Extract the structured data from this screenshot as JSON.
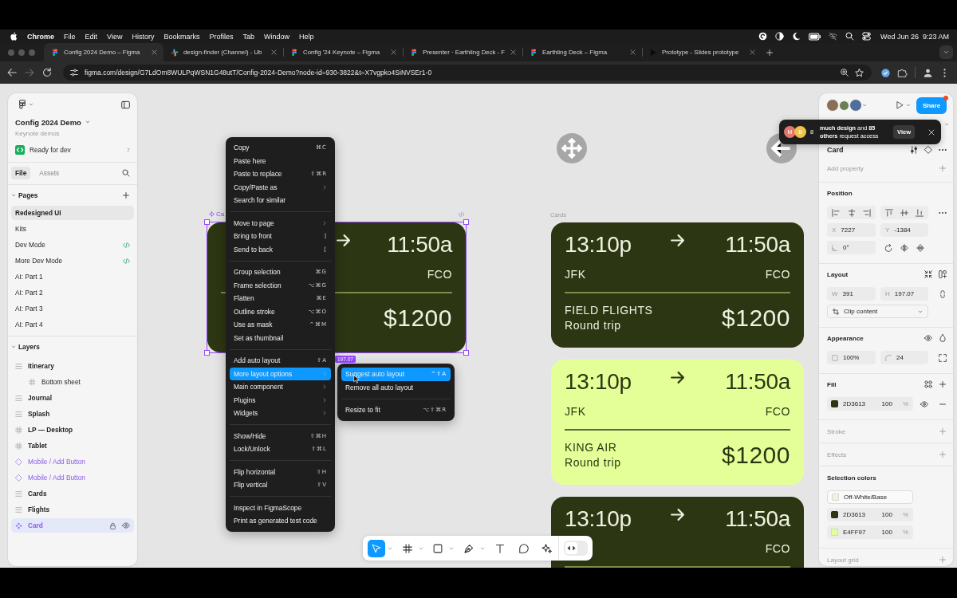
{
  "menubar": {
    "app": "Chrome",
    "menus": [
      "File",
      "Edit",
      "View",
      "History",
      "Bookmarks",
      "Profiles",
      "Tab",
      "Window",
      "Help"
    ],
    "date": "Wed Jun 26",
    "time": "9:23 AM"
  },
  "tabs": [
    {
      "title": "Config 2024 Demo – Figma",
      "kind": "figma",
      "selected": true
    },
    {
      "title": "design-finder (Channel) - Ub",
      "kind": "slack",
      "selected": false
    },
    {
      "title": "Config '24 Keynote – Figma",
      "kind": "figma",
      "selected": false
    },
    {
      "title": "Presenter · Earthling Deck - F",
      "kind": "figma",
      "selected": false
    },
    {
      "title": "Earthling Deck – Figma",
      "kind": "figma",
      "selected": false
    },
    {
      "title": "Prototype - Slides prototype",
      "kind": "prototype",
      "selected": false
    }
  ],
  "address_bar": {
    "url": "figma.com/design/G7LdOm8WULPqWSN1G48utT/Config-2024-Demo?node-id=930-3822&t=X7vgpko4SiNVSEr1-0"
  },
  "sidebar": {
    "file_name": "Config 2024 Demo",
    "team": "Keynote demos",
    "status": {
      "label": "Ready for dev",
      "count": "7"
    },
    "tabs": [
      {
        "label": "File",
        "selected": true
      },
      {
        "label": "Assets",
        "selected": false
      }
    ],
    "pages": {
      "title": "Pages",
      "expanded": true,
      "items": [
        {
          "name": "Redesigned UI",
          "selected": true,
          "dev_mode": false
        },
        {
          "name": "Kits",
          "selected": false,
          "dev_mode": false
        },
        {
          "name": "Dev Mode",
          "selected": false,
          "dev_mode": true
        },
        {
          "name": "More Dev Mode",
          "selected": false,
          "dev_mode": true
        },
        {
          "name": "AI: Part 1",
          "selected": false,
          "dev_mode": false
        },
        {
          "name": "AI: Part 2",
          "selected": false,
          "dev_mode": false
        },
        {
          "name": "AI: Part 3",
          "selected": false,
          "dev_mode": false
        },
        {
          "name": "AI: Part 4",
          "selected": false,
          "dev_mode": false
        }
      ]
    },
    "layers": {
      "title": "Layers",
      "expanded": true,
      "items": [
        {
          "name": "Itinerary",
          "kind": "stack",
          "selected": false,
          "children": [
            {
              "name": "Bottom sheet",
              "kind": "grid",
              "selected": false
            }
          ]
        },
        {
          "name": "Journal",
          "kind": "stack",
          "selected": false
        },
        {
          "name": "Splash",
          "kind": "stack",
          "selected": false
        },
        {
          "name": "LP — Desktop",
          "kind": "frame",
          "selected": false
        },
        {
          "name": "Tablet",
          "kind": "frame",
          "selected": false
        },
        {
          "name": "Mobile / Add Button",
          "kind": "instance",
          "selected": false
        },
        {
          "name": "Mobile / Add Button",
          "kind": "instance",
          "selected": false
        },
        {
          "name": "Cards",
          "kind": "stack",
          "selected": false
        },
        {
          "name": "Flights",
          "kind": "stack",
          "selected": false
        },
        {
          "name": "Card",
          "kind": "component",
          "selected": true
        }
      ]
    }
  },
  "canvas": {
    "selection": {
      "label": "Ca",
      "size": "197.07",
      "card": {
        "arrive": "11:50a",
        "to": "FCO",
        "price": "$1200",
        "color": "#2D3613"
      }
    },
    "frame_label": "Cards",
    "cards": [
      {
        "depart": "13:10p",
        "arrive": "11:50a",
        "from": "JFK",
        "to": "FCO",
        "airline": "FIELD FLIGHTS",
        "trip": "Round trip",
        "price": "$1200",
        "color": "#2D3613"
      },
      {
        "depart": "13:10p",
        "arrive": "11:50a",
        "from": "JFK",
        "to": "FCO",
        "airline": "KING AIR",
        "trip": "Round trip",
        "price": "$1200",
        "color": "#E4FF97"
      },
      {
        "depart": "13:10p",
        "arrive": "11:50a",
        "to": "FCO",
        "color": "#2D3613"
      }
    ]
  },
  "context_menu": {
    "groups": [
      {
        "items": [
          {
            "label": "Copy",
            "shortcut": "⌘C",
            "submenu": false,
            "selected": false
          },
          {
            "label": "Paste here",
            "submenu": false,
            "selected": false
          },
          {
            "label": "Paste to replace",
            "shortcut": "⇧⌘R",
            "submenu": false,
            "selected": false
          },
          {
            "label": "Copy/Paste as",
            "submenu": true,
            "selected": false
          },
          {
            "label": "Search for similar",
            "submenu": false,
            "selected": false
          }
        ]
      },
      {
        "items": [
          {
            "label": "Move to page",
            "submenu": true,
            "selected": false
          },
          {
            "label": "Bring to front",
            "shortcut": "]",
            "submenu": false,
            "selected": false
          },
          {
            "label": "Send to back",
            "shortcut": "[",
            "submenu": false,
            "selected": false
          }
        ]
      },
      {
        "items": [
          {
            "label": "Group selection",
            "shortcut": "⌘G",
            "submenu": false,
            "selected": false
          },
          {
            "label": "Frame selection",
            "shortcut": "⌥⌘G",
            "submenu": false,
            "selected": false
          },
          {
            "label": "Flatten",
            "shortcut": "⌘E",
            "submenu": false,
            "selected": false
          },
          {
            "label": "Outline stroke",
            "shortcut": "⌥⌘O",
            "submenu": false,
            "selected": false
          },
          {
            "label": "Use as mask",
            "shortcut": "^⌘M",
            "submenu": false,
            "selected": false
          },
          {
            "label": "Set as thumbnail",
            "submenu": false,
            "selected": false
          }
        ]
      },
      {
        "items": [
          {
            "label": "Add auto layout",
            "shortcut": "⇧A",
            "submenu": false,
            "selected": false
          },
          {
            "label": "More layout options",
            "submenu": true,
            "selected": true
          },
          {
            "label": "Main component",
            "submenu": true,
            "selected": false
          },
          {
            "label": "Plugins",
            "submenu": true,
            "selected": false
          },
          {
            "label": "Widgets",
            "submenu": true,
            "selected": false
          }
        ]
      },
      {
        "items": [
          {
            "label": "Show/Hide",
            "shortcut": "⇧⌘H",
            "submenu": false,
            "selected": false
          },
          {
            "label": "Lock/Unlock",
            "shortcut": "⇧⌘L",
            "submenu": false,
            "selected": false
          }
        ]
      },
      {
        "items": [
          {
            "label": "Flip horizontal",
            "shortcut": "⇧H",
            "submenu": false,
            "selected": false
          },
          {
            "label": "Flip vertical",
            "shortcut": "⇧V",
            "submenu": false,
            "selected": false
          }
        ]
      },
      {
        "items": [
          {
            "label": "Inspect in FigmaScope",
            "submenu": false,
            "selected": false
          },
          {
            "label": "Print as generated test code",
            "submenu": false,
            "selected": false
          }
        ]
      }
    ]
  },
  "submenu": {
    "groups": [
      {
        "items": [
          {
            "label": "Suggest auto layout",
            "shortcut": "^⇧A",
            "selected": true
          },
          {
            "label": "Remove all auto layout",
            "selected": false
          }
        ]
      },
      {
        "items": [
          {
            "label": "Resize to fit",
            "shortcut": "⌥⇧⌘R",
            "selected": false
          }
        ]
      }
    ]
  },
  "toast": {
    "avatars": [
      {
        "initial": "M",
        "color": "#E2786C"
      },
      {
        "initial": "B",
        "color": "#F1C24B"
      }
    ],
    "count": "8",
    "message": "**much design** and **85 others** request access",
    "action": "View"
  },
  "header": {
    "share": "Share",
    "unread": true
  },
  "design": {
    "component": "Card",
    "add_property": "Add property",
    "position": {
      "title": "Position",
      "x": {
        "label": "X",
        "value": "7227"
      },
      "y": {
        "label": "Y",
        "value": "-1384"
      },
      "rotation": "0°"
    },
    "layout": {
      "title": "Layout",
      "w": {
        "label": "W",
        "value": "391"
      },
      "h": {
        "label": "H",
        "value": "197.07"
      },
      "clip": "Clip content"
    },
    "appearance": {
      "title": "Appearance",
      "opacity": "100%",
      "radius": "24"
    },
    "fill": {
      "title": "Fill",
      "items": [
        {
          "hex": "2D3613",
          "opacity": "100",
          "unit": "%",
          "color": "#2D3613"
        }
      ]
    },
    "empty_sections": [
      "Stroke",
      "Effects"
    ],
    "selection_colors": {
      "title": "Selection colors",
      "items": [
        {
          "kind": "style",
          "name": "Off-White/Base",
          "color": "#EEF2E1"
        },
        {
          "kind": "hex",
          "name": "2D3613",
          "opacity": "100",
          "unit": "%",
          "color": "#2D3613"
        },
        {
          "kind": "hex",
          "name": "E4FF97",
          "opacity": "100",
          "unit": "%",
          "color": "#E4FF97"
        }
      ]
    },
    "layout_grid": "Layout grid"
  },
  "toolbar": {
    "tools": [
      {
        "kind": "move",
        "selected": true,
        "menu": true
      },
      {
        "kind": "frame",
        "selected": false,
        "menu": true
      },
      {
        "kind": "shape",
        "selected": false,
        "menu": true
      },
      {
        "kind": "pen",
        "selected": false,
        "menu": true
      },
      {
        "kind": "text",
        "selected": false,
        "menu": false
      },
      {
        "kind": "comment",
        "selected": false,
        "menu": false
      },
      {
        "kind": "actions",
        "selected": false,
        "menu": false
      }
    ],
    "dev_mode": {
      "on": false
    }
  }
}
